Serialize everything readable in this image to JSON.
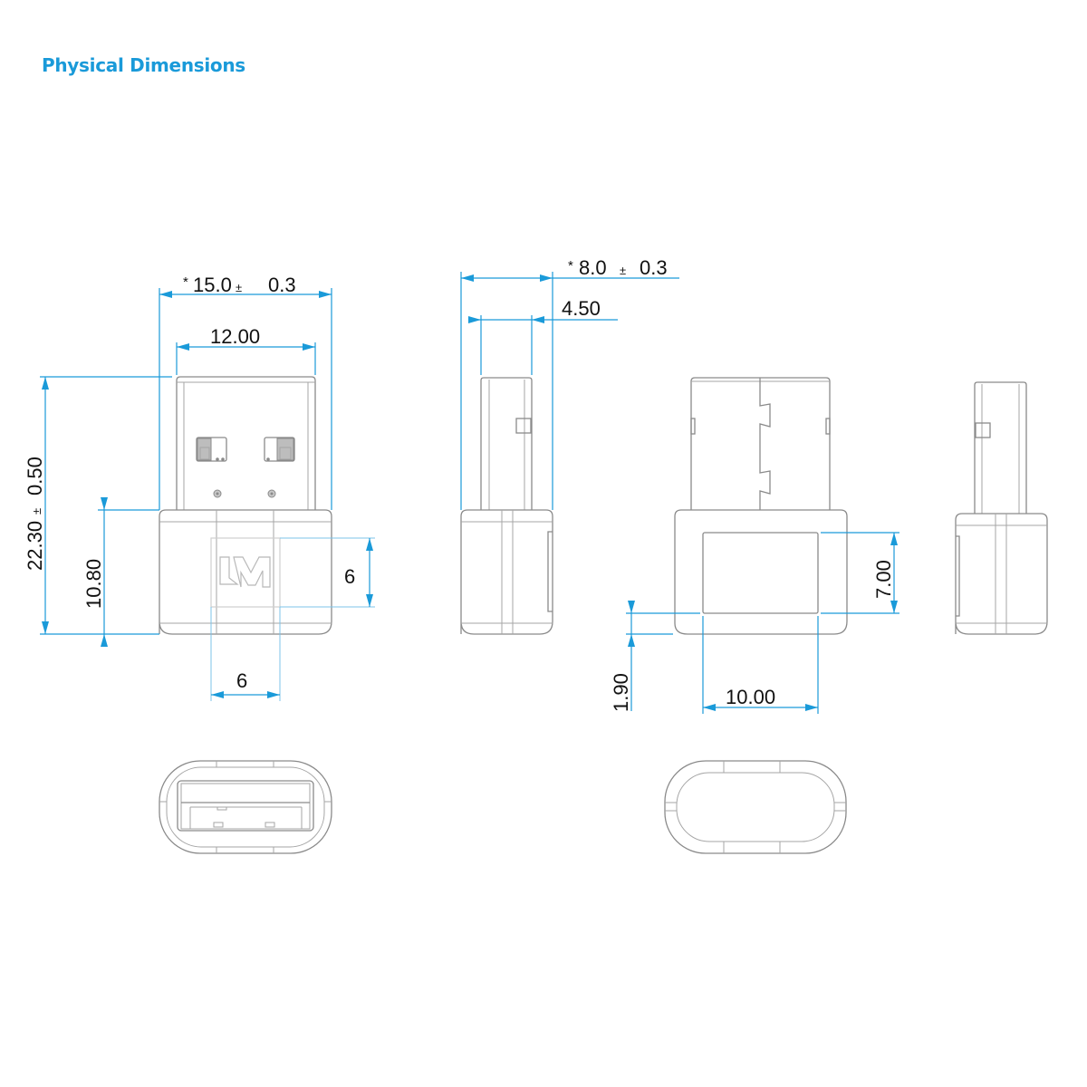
{
  "title": "Physical Dimensions",
  "logo_text": "LM",
  "accent_color": "#1a9ad9",
  "units": "mm",
  "views": {
    "front": {
      "overall_width": {
        "prefix": "*",
        "value": "15.0",
        "pm": "±",
        "tolerance": "0.3"
      },
      "plug_width": {
        "value": "12.00"
      },
      "overall_height": {
        "value": "22.30",
        "pm": "±",
        "tolerance": "0.50"
      },
      "body_height": {
        "value": "10.80"
      },
      "logo_height": {
        "value": "6"
      },
      "logo_width": {
        "value": "6"
      }
    },
    "side": {
      "overall_depth": {
        "prefix": "*",
        "value": "8.0",
        "pm": "±",
        "tolerance": "0.3"
      },
      "plug_depth": {
        "value": "4.50"
      }
    },
    "back": {
      "window_height": {
        "value": "7.00"
      },
      "window_width": {
        "value": "10.00"
      },
      "window_offset": {
        "value": "1.90"
      }
    },
    "side_right": {},
    "top_front": {},
    "top_back": {}
  }
}
